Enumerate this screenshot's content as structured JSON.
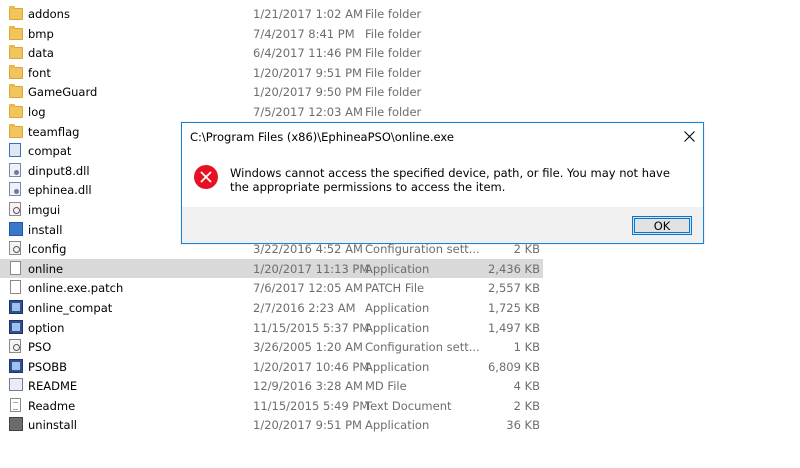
{
  "files": [
    {
      "name": "addons",
      "date": "1/21/2017 1:02 AM",
      "type": "File folder",
      "size": "",
      "icon": "folder-icon"
    },
    {
      "name": "bmp",
      "date": "7/4/2017 8:41 PM",
      "type": "File folder",
      "size": "",
      "icon": "folder-icon"
    },
    {
      "name": "data",
      "date": "6/4/2017 11:46 PM",
      "type": "File folder",
      "size": "",
      "icon": "folder-icon"
    },
    {
      "name": "font",
      "date": "1/20/2017 9:51 PM",
      "type": "File folder",
      "size": "",
      "icon": "folder-icon"
    },
    {
      "name": "GameGuard",
      "date": "1/20/2017 9:50 PM",
      "type": "File folder",
      "size": "",
      "icon": "folder-icon"
    },
    {
      "name": "log",
      "date": "7/5/2017 12:03 AM",
      "type": "File folder",
      "size": "",
      "icon": "folder-icon"
    },
    {
      "name": "teamflag",
      "date": "",
      "type": "",
      "size": "",
      "icon": "folder-icon"
    },
    {
      "name": "compat",
      "date": "",
      "type": "",
      "size": "",
      "icon": "compat-file-icon"
    },
    {
      "name": "dinput8.dll",
      "date": "",
      "type": "",
      "size": "",
      "icon": "dll-file-icon"
    },
    {
      "name": "ephinea.dll",
      "date": "",
      "type": "",
      "size": "",
      "icon": "dll-file-icon"
    },
    {
      "name": "imgui",
      "date": "",
      "type": "",
      "size": "",
      "icon": "config-file-icon"
    },
    {
      "name": "install",
      "date": "",
      "type": "",
      "size": "",
      "icon": "setup-file-icon"
    },
    {
      "name": "lconfig",
      "date": "3/22/2016 4:52 AM",
      "type": "Configuration sett...",
      "size": "2 KB",
      "icon": "config-file-icon"
    },
    {
      "name": "online",
      "date": "1/20/2017 11:13 PM",
      "type": "Application",
      "size": "2,436 KB",
      "icon": "blank-file-icon",
      "selected": true
    },
    {
      "name": "online.exe.patch",
      "date": "7/6/2017 12:05 AM",
      "type": "PATCH File",
      "size": "2,557 KB",
      "icon": "blank-file-icon"
    },
    {
      "name": "online_compat",
      "date": "2/7/2016 2:23 AM",
      "type": "Application",
      "size": "1,725 KB",
      "icon": "exe-file-icon"
    },
    {
      "name": "option",
      "date": "11/15/2015 5:37 PM",
      "type": "Application",
      "size": "1,497 KB",
      "icon": "exe-file-icon"
    },
    {
      "name": "PSO",
      "date": "3/26/2005 1:20 AM",
      "type": "Configuration sett...",
      "size": "1 KB",
      "icon": "config-file-icon"
    },
    {
      "name": "PSOBB",
      "date": "1/20/2017 10:46 PM",
      "type": "Application",
      "size": "6,809 KB",
      "icon": "exe-file-icon"
    },
    {
      "name": "README",
      "date": "12/9/2016 3:28 AM",
      "type": "MD File",
      "size": "4 KB",
      "icon": "readme-file-icon"
    },
    {
      "name": "Readme",
      "date": "11/15/2015 5:49 PM",
      "type": "Text Document",
      "size": "2 KB",
      "icon": "text-file-icon"
    },
    {
      "name": "uninstall",
      "date": "1/20/2017 9:51 PM",
      "type": "Application",
      "size": "36 KB",
      "icon": "uninstall-file-icon"
    }
  ],
  "dialog": {
    "title": "C:\\Program Files (x86)\\EphineaPSO\\online.exe",
    "message": "Windows cannot access the specified device, path, or file. You may not have the appropriate permissions to access the item.",
    "ok_label": "OK",
    "icon": "error-icon",
    "close_icon": "close-icon",
    "accent_color": "#1883d7",
    "error_color": "#e81123"
  }
}
